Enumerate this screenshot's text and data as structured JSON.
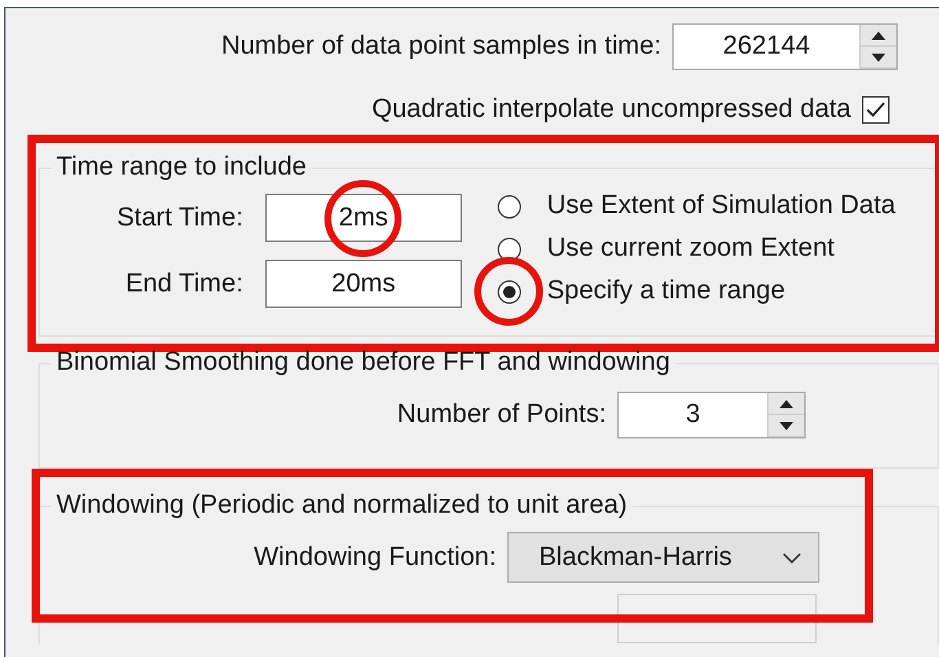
{
  "sample_count": {
    "label": "Number of data point samples in time:",
    "value": "262144"
  },
  "quadratic": {
    "label": "Quadratic interpolate uncompressed data",
    "checked": true
  },
  "time_range": {
    "title": "Time range to include",
    "highlighted": true,
    "start": {
      "label": "Start Time:",
      "value": "2ms",
      "circled": true
    },
    "end": {
      "label": "End Time:",
      "value": "20ms",
      "circled": false
    },
    "options": [
      {
        "label": "Use Extent of Simulation Data",
        "selected": false,
        "circled": false
      },
      {
        "label": "Use current zoom Extent",
        "selected": false,
        "circled": false
      },
      {
        "label": "Specify a time range",
        "selected": true,
        "circled": true
      }
    ]
  },
  "smoothing": {
    "title": "Binomial Smoothing done before FFT and windowing",
    "points": {
      "label": "Number of Points:",
      "value": "3"
    }
  },
  "windowing": {
    "title": "Windowing  (Periodic and normalized to unit area)",
    "highlighted": true,
    "function": {
      "label": "Windowing Function:",
      "value": "Blackman-Harris"
    },
    "kaiser": {
      "disabled": true
    }
  }
}
